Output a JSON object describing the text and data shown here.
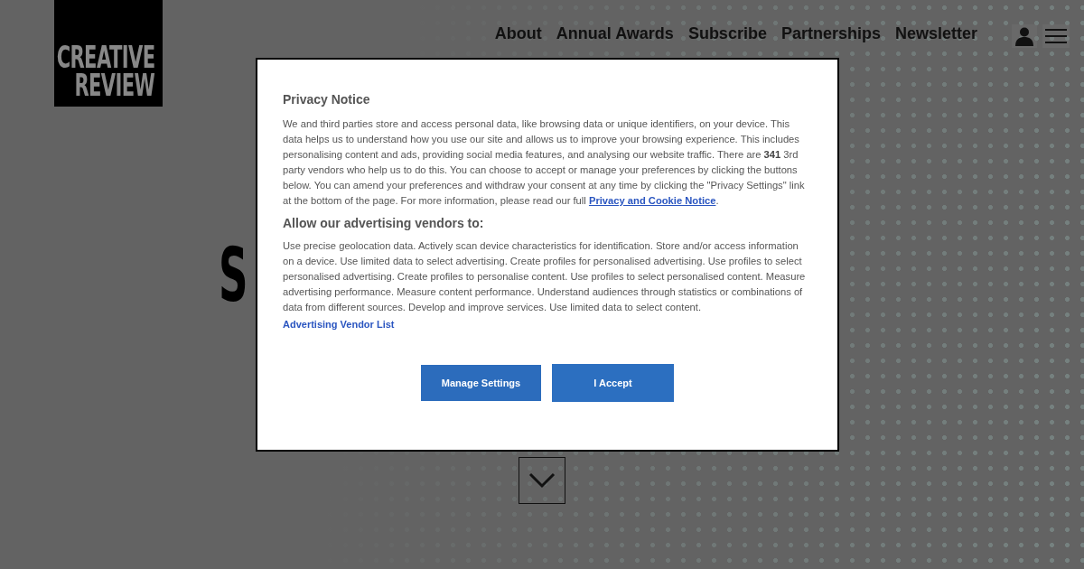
{
  "logo": {
    "lines": [
      "CREATIVE",
      "REVIEW"
    ]
  },
  "nav": {
    "links": [
      "About",
      "Annual Awards",
      "Subscribe",
      "Partnerships",
      "Newsletter"
    ]
  },
  "headline": {
    "fragments": [
      "S"
    ]
  },
  "dialog": {
    "title": "Privacy Notice",
    "intro": "We and third parties store and access personal data, like browsing data or unique identifiers, on your device. This data helps us to understand how you use our site and allows us to improve your browsing experience. This includes personalising content and ads, providing social media features, and analysing our website traffic. There are **341** 3rd party vendors who help us to do this. You can choose to accept or manage your preferences by clicking the buttons below. You can amend your preferences and withdraw your consent at any time by clicking the \"Privacy Settings\" link at the bottom of the page. For more information, please read our full ",
    "intro_link": "Privacy and Cookie Notice",
    "intro_end": ".",
    "section_title": "Allow our advertising vendors to:",
    "purposes": "Use precise geolocation data. Actively scan device characteristics for identification. Store and/or access information on a device. Use limited data to select advertising. Create profiles for personalised advertising. Use profiles to select personalised advertising. Create profiles to personalise content. Use profiles to select personalised content. Measure advertising performance. Measure content performance. Understand audiences through statistics or combinations of data from different sources. Develop and improve services. Use limited data to select content.",
    "vendor_link": "Advertising Vendor List",
    "buttons": [
      {
        "label": "Manage Settings",
        "kind": "secondary"
      },
      {
        "label": "I Accept",
        "kind": "primary"
      }
    ]
  }
}
